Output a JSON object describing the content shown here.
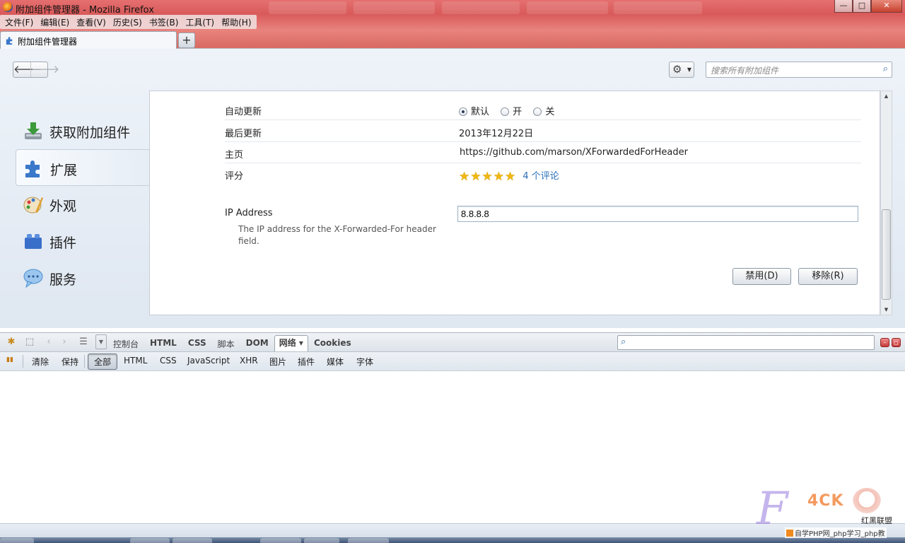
{
  "window": {
    "title": "附加组件管理器 - Mozilla Firefox",
    "buttons": {
      "minimize": "—",
      "maximize": "□",
      "close": "✕"
    }
  },
  "menubar": {
    "items": [
      {
        "label": "文件(F)"
      },
      {
        "label": "编辑(E)"
      },
      {
        "label": "查看(V)"
      },
      {
        "label": "历史(S)"
      },
      {
        "label": "书签(B)"
      },
      {
        "label": "工具(T)"
      },
      {
        "label": "帮助(H)"
      }
    ]
  },
  "tabs": {
    "active_label": "附加组件管理器",
    "new_tab_label": "+"
  },
  "addons": {
    "nav": {
      "back": "🡐",
      "forward": "🡒"
    },
    "gear_icon": "⚙",
    "search": {
      "placeholder": "搜索所有附加组件",
      "icon": "⌕"
    },
    "categories": [
      {
        "label": "获取附加组件",
        "icon": "download-icon",
        "color": "#3c9a3c"
      },
      {
        "label": "扩展",
        "icon": "puzzle-icon",
        "color": "#3a78c9"
      },
      {
        "label": "外观",
        "icon": "palette-icon",
        "color": "#e0a030"
      },
      {
        "label": "插件",
        "icon": "plugin-block-icon",
        "color": "#3a6fc9"
      },
      {
        "label": "服务",
        "icon": "chat-bubble-icon",
        "color": "#4a90d0"
      }
    ],
    "detail": {
      "auto_update": {
        "label": "自动更新",
        "options": [
          {
            "label": "默认",
            "selected": true
          },
          {
            "label": "开",
            "selected": false
          },
          {
            "label": "关",
            "selected": false
          }
        ]
      },
      "last_updated": {
        "label": "最后更新",
        "value": "2013年12月22日"
      },
      "homepage": {
        "label": "主页",
        "value": "https://github.com/marson/XForwardedForHeader"
      },
      "rating": {
        "label": "评分",
        "stars": "★★★★★",
        "star_count": 5,
        "reviews": "4 个评论"
      },
      "ip": {
        "label": "IP Address",
        "description": "The IP address for the X-Forwarded-For header field.",
        "value": "8.8.8.8"
      },
      "buttons": {
        "disable": "禁用(D)",
        "remove": "移除(R)"
      }
    }
  },
  "firebug": {
    "tabs": [
      {
        "label": "控制台",
        "active": false
      },
      {
        "label": "HTML",
        "active": false
      },
      {
        "label": "CSS",
        "active": false
      },
      {
        "label": "脚本",
        "active": false
      },
      {
        "label": "DOM",
        "active": false
      },
      {
        "label": "网络 ▾",
        "active": true
      },
      {
        "label": "Cookies",
        "active": false
      }
    ],
    "filters": {
      "clear": "清除",
      "persist": "保持",
      "items": [
        "全部",
        "HTML",
        "CSS",
        "JavaScript",
        "XHR",
        "图片",
        "插件",
        "媒体",
        "字体"
      ],
      "active": "全部"
    }
  },
  "watermark": {
    "big_letter": "F",
    "brand": "4CK",
    "hongke": "红黑联盟",
    "php": "自学PHP网_php学习_php教"
  }
}
